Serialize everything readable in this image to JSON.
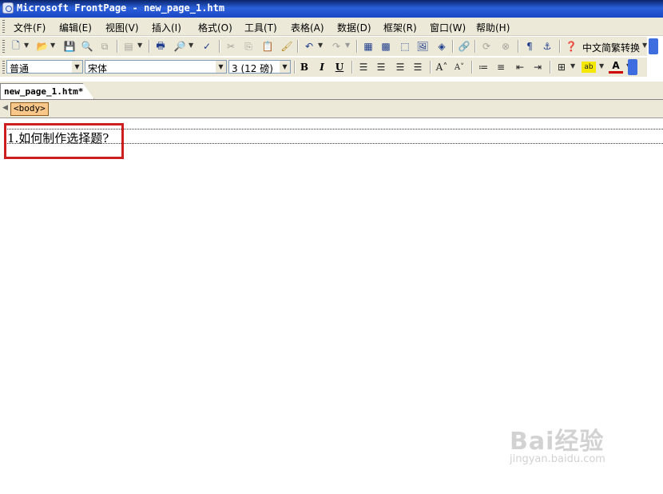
{
  "window": {
    "title": "Microsoft FrontPage - new_page_1.htm"
  },
  "menu": [
    {
      "label": "文件(F)"
    },
    {
      "label": "编辑(E)"
    },
    {
      "label": "视图(V)"
    },
    {
      "label": "插入(I)"
    },
    {
      "label": "格式(O)"
    },
    {
      "label": "工具(T)"
    },
    {
      "label": "表格(A)"
    },
    {
      "label": "数据(D)"
    },
    {
      "label": "框架(R)"
    },
    {
      "label": "窗口(W)"
    },
    {
      "label": "帮助(H)"
    }
  ],
  "standard_toolbar": {
    "chinese_convert_label": "中文简繁转换",
    "icons": [
      "new-icon",
      "open-icon",
      "save-icon",
      "search-icon",
      "publish-icon",
      "toggle-pane-icon",
      "print-icon",
      "print-preview-icon",
      "spelling-icon",
      "cut-icon",
      "copy-icon",
      "paste-icon",
      "format-painter-icon",
      "undo-icon",
      "redo-icon",
      "web-component-icon",
      "insert-table-icon",
      "insert-layer-icon",
      "insert-picture-icon",
      "drawing-icon",
      "hyperlink-icon",
      "refresh-icon",
      "stop-icon",
      "show-all-icon",
      "bookmark-icon",
      "help-icon"
    ]
  },
  "formatting_toolbar": {
    "style": "普通",
    "font": "宋体",
    "size": "3 (12 磅)",
    "bold": "B",
    "italic": "I",
    "underline": "U"
  },
  "document_tabs": [
    {
      "label": "new_page_1.htm*"
    }
  ],
  "tag_selector": {
    "tag": "<body>"
  },
  "editor": {
    "text": "1.如何制作选择题?"
  },
  "watermark": {
    "brand": "Bai经验",
    "url": "jingyan.baidu.com"
  }
}
